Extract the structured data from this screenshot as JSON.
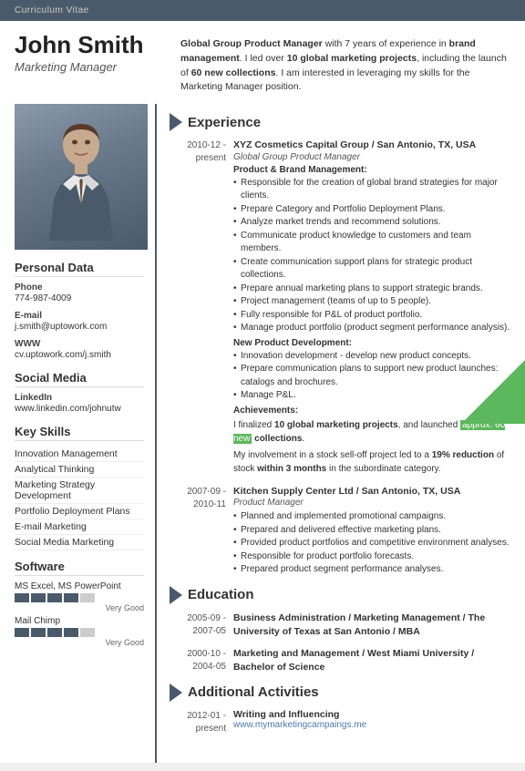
{
  "header": {
    "label": "Curriculum Vitae"
  },
  "person": {
    "name": "John Smith",
    "title": "Marketing Manager",
    "summary": "Global Group Product Manager with 7 years of experience in brand management. I led over 10 global marketing projects, including the launch of 60 new collections. I am interested in leveraging my skills for the Marketing Manager position."
  },
  "personal_data": {
    "section_label": "Personal Data",
    "phone_label": "Phone",
    "phone": "774-987-4009",
    "email_label": "E-mail",
    "email": "j.smith@uptowork.com",
    "www_label": "WWW",
    "www": "cv.uptowork.com/j.smith"
  },
  "social_media": {
    "section_label": "Social Media",
    "linkedin_label": "LinkedIn",
    "linkedin": "www.linkedin.com/johnutw"
  },
  "key_skills": {
    "section_label": "Key Skills",
    "items": [
      "Innovation Management",
      "Analytical Thinking",
      "Marketing Strategy Development",
      "Portfolio Deployment Plans",
      "E-mail Marketing",
      "Social Media Marketing"
    ]
  },
  "software": {
    "section_label": "Software",
    "items": [
      {
        "name": "MS Excel, MS PowerPoint",
        "level": "Very Good",
        "filled": 4,
        "total": 5
      },
      {
        "name": "Mail Chimp",
        "level": "Very Good",
        "filled": 4,
        "total": 5
      }
    ]
  },
  "experience": {
    "section_label": "Experience",
    "entries": [
      {
        "date_start": "2010-12 -",
        "date_end": "present",
        "company": "XYZ Cosmetics Capital Group / San Antonio, TX, USA",
        "role": "Global Group Product Manager",
        "subsections": [
          {
            "subtitle": "Product & Brand Management:",
            "bullets": [
              "Responsible for the creation of global brand strategies for major clients.",
              "Prepare Category and Portfolio Deployment Plans.",
              "Analyze market trends and recommend solutions.",
              "Communicate product knowledge to customers and team members.",
              "Create communication support plans for strategic product collections.",
              "Prepare annual marketing plans to support strategic brands.",
              "Project management (teams of up to 5 people).",
              "Fully responsible for P&L of product portfolio.",
              "Manage product portfolio (product segment performance analysis)."
            ]
          },
          {
            "subtitle": "New Product Development:",
            "bullets": [
              "Innovation development - develop new product concepts.",
              "Prepare communication plans to support new product launches: catalogs and brochures.",
              "Manage P&L."
            ]
          }
        ],
        "achievements_label": "Achievements:",
        "achievement_text": "I finalized 10 global marketing projects, and launched approx. 60 new collections.",
        "achievement_text2": "My involvement in a stock sell-off project led to a 19% reduction of stock within 3 months in the subordinate category."
      },
      {
        "date_start": "2007-09 -",
        "date_end": "2010-11",
        "company": "Kitchen Supply Center Ltd / San Antonio, TX, USA",
        "role": "Product Manager",
        "subsections": [
          {
            "subtitle": "",
            "bullets": [
              "Planned and implemented promotional campaigns.",
              "Prepared and delivered effective marketing plans.",
              "Provided product portfolios and competitive environment analyses.",
              "Responsible for product portfolio forecasts.",
              "Prepared product segment performance analyses."
            ]
          }
        ]
      }
    ]
  },
  "education": {
    "section_label": "Education",
    "entries": [
      {
        "date_start": "2005-09 -",
        "date_end": "2007-05",
        "degree": "Business Administration / Marketing Management / The University of Texas at San Antonio / MBA"
      },
      {
        "date_start": "2000-10 -",
        "date_end": "2004-05",
        "degree": "Marketing and Management / West Miami University / Bachelor of Science"
      }
    ]
  },
  "additional": {
    "section_label": "Additional Activities",
    "entries": [
      {
        "date_start": "2012-01 -",
        "date_end": "present",
        "title": "Writing and Influencing",
        "link": "www.mymarketingcampaings.me"
      }
    ]
  }
}
